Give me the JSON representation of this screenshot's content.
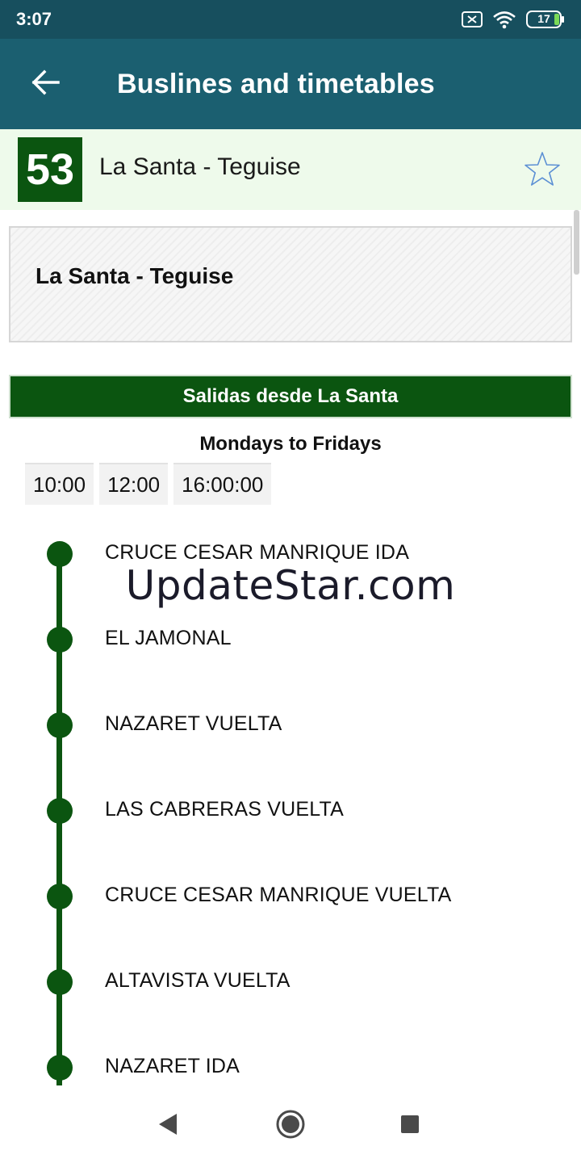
{
  "status_bar": {
    "time": "3:07",
    "battery_level": "17"
  },
  "app_bar": {
    "title": "Buslines and timetables"
  },
  "route": {
    "number": "53",
    "name": "La Santa - Teguise"
  },
  "info_box": {
    "title": "La Santa - Teguise"
  },
  "departures": {
    "header": "Salidas desde La Santa",
    "days": "Mondays to Fridays",
    "times": [
      "10:00",
      "12:00",
      "16:00:00"
    ]
  },
  "stops": [
    "CRUCE CESAR MANRIQUE IDA",
    "EL JAMONAL",
    "NAZARET VUELTA",
    "LAS CABRERAS VUELTA",
    "CRUCE CESAR MANRIQUE VUELTA",
    "ALTAVISTA VUELTA",
    "NAZARET IDA"
  ],
  "watermark": "UpdateStar.com",
  "colors": {
    "status_bar": "#174f5e",
    "app_bar": "#1b5f70",
    "route_green": "#0b5510",
    "header_bg": "#eefaeb"
  },
  "icons": {
    "back": "arrow-back-icon",
    "favorite": "star-outline-icon",
    "nav_back": "triangle-back-icon",
    "nav_home": "circle-home-icon",
    "nav_recents": "square-recents-icon"
  }
}
